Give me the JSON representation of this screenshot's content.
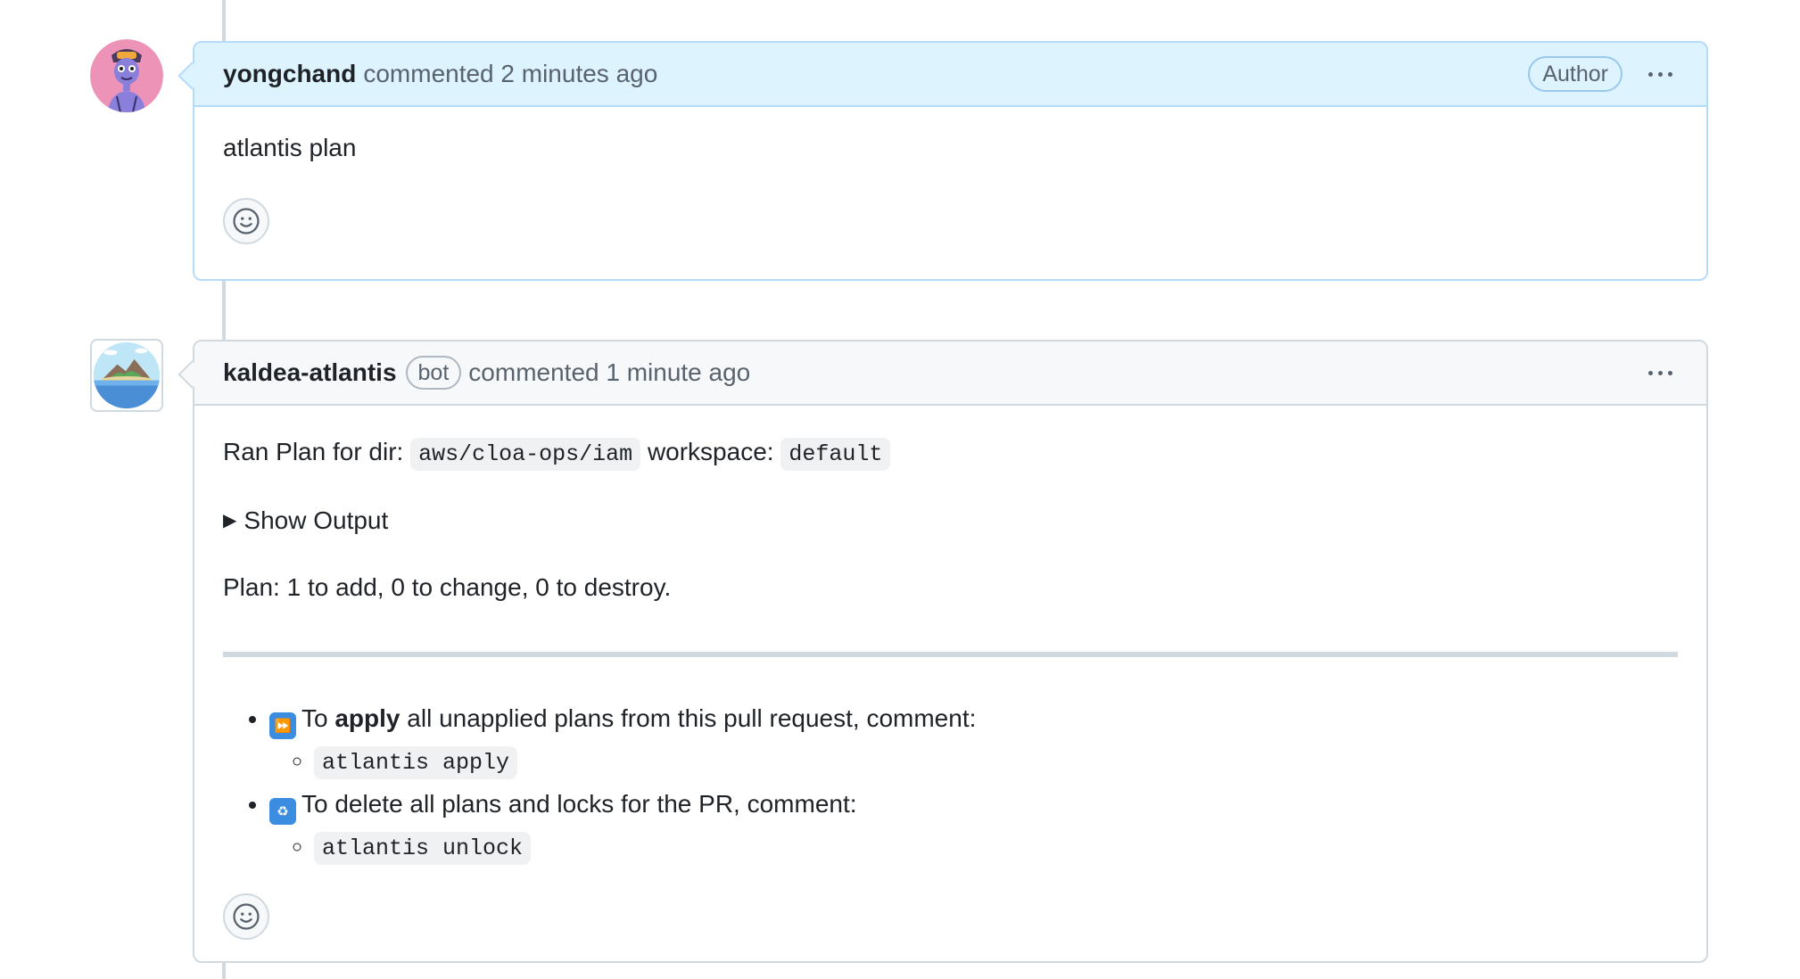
{
  "comments": [
    {
      "username": "yongchand",
      "meta": "commented 2 minutes ago",
      "role_label": "Author",
      "body": "atlantis plan"
    },
    {
      "username": "kaldea-atlantis",
      "bot_label": "bot",
      "meta": "commented 1 minute ago",
      "plan_line": {
        "prefix": "Ran Plan for dir:",
        "dir": "aws/cloa-ops/iam",
        "workspace_label": "workspace:",
        "workspace": "default"
      },
      "details_summary": "Show Output",
      "plan_summary": "Plan: 1 to add, 0 to change, 0 to destroy.",
      "tips": [
        {
          "emoji": "fast-forward-emoji",
          "text_before": "To",
          "emphasis": "apply",
          "text_after": "all unapplied plans from this pull request, comment:",
          "command": "atlantis apply"
        },
        {
          "emoji": "put-litter-in-its-place-emoji",
          "text": "To delete all plans and locks for the PR, comment:",
          "command": "atlantis unlock"
        }
      ]
    }
  ]
}
